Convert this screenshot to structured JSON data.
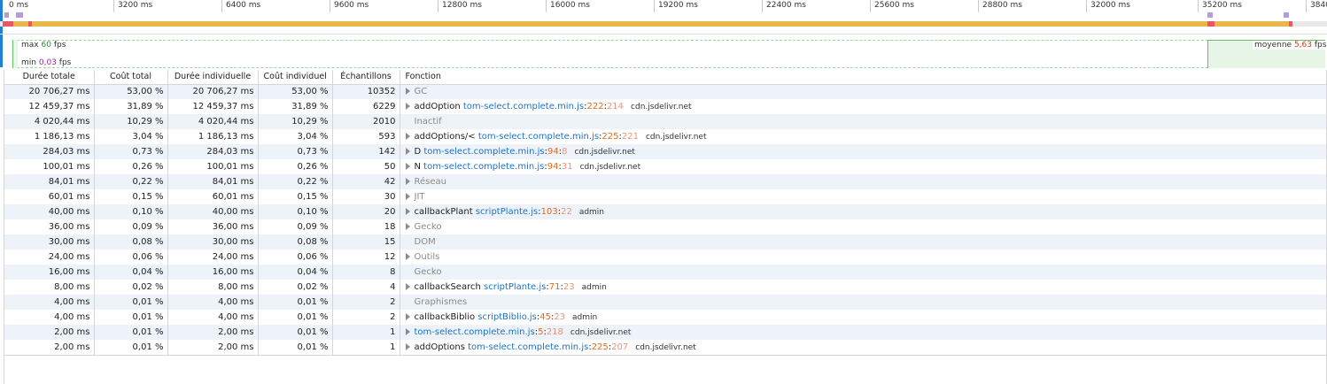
{
  "timeline": {
    "ticks": [
      "0 ms",
      "3200 ms",
      "6400 ms",
      "9600 ms",
      "12800 ms",
      "16000 ms",
      "19200 ms",
      "22400 ms",
      "25600 ms",
      "28800 ms",
      "32000 ms",
      "35200 ms",
      "3840"
    ],
    "colors": {
      "gc_bar": "#e8b84a",
      "purple_marker": "#b59cdb",
      "red_segment": "#e8566a",
      "blue_marker": "#1f7fd9"
    }
  },
  "fps": {
    "max_label": "max",
    "max_value": "60",
    "min_label": "min",
    "min_value": "0,03",
    "avg_label": "moyenne",
    "avg_value": "5,63",
    "unit": "fps"
  },
  "table": {
    "headers": [
      "Durée totale",
      "Coût total",
      "Durée individuelle",
      "Coût individuel",
      "Échantillons",
      "Fonction"
    ],
    "rows": [
      {
        "total": "20 706,27 ms",
        "cost": "53,00 %",
        "self": "20 706,27 ms",
        "self_cost": "53,00 %",
        "samples": "10352",
        "expand": true,
        "name": "GC",
        "dim": true,
        "file": "",
        "line": "",
        "col": "",
        "host": ""
      },
      {
        "total": "12 459,37 ms",
        "cost": "31,89 %",
        "self": "12 459,37 ms",
        "self_cost": "31,89 %",
        "samples": "6229",
        "expand": true,
        "name": "addOption",
        "dim": false,
        "file": "tom-select.complete.min.js",
        "line": "222",
        "col": "214",
        "host": "cdn.jsdelivr.net"
      },
      {
        "total": "4 020,44 ms",
        "cost": "10,29 %",
        "self": "4 020,44 ms",
        "self_cost": "10,29 %",
        "samples": "2010",
        "expand": false,
        "name": "Inactif",
        "dim": true,
        "file": "",
        "line": "",
        "col": "",
        "host": ""
      },
      {
        "total": "1 186,13 ms",
        "cost": "3,04 %",
        "self": "1 186,13 ms",
        "self_cost": "3,04 %",
        "samples": "593",
        "expand": true,
        "name": "addOptions/<",
        "dim": false,
        "file": "tom-select.complete.min.js",
        "line": "225",
        "col": "221",
        "host": "cdn.jsdelivr.net"
      },
      {
        "total": "284,03 ms",
        "cost": "0,73 %",
        "self": "284,03 ms",
        "self_cost": "0,73 %",
        "samples": "142",
        "expand": true,
        "name": "D",
        "dim": false,
        "file": "tom-select.complete.min.js",
        "line": "94",
        "col": "8",
        "host": "cdn.jsdelivr.net"
      },
      {
        "total": "100,01 ms",
        "cost": "0,26 %",
        "self": "100,01 ms",
        "self_cost": "0,26 %",
        "samples": "50",
        "expand": true,
        "name": "N",
        "dim": false,
        "file": "tom-select.complete.min.js",
        "line": "94",
        "col": "31",
        "host": "cdn.jsdelivr.net"
      },
      {
        "total": "84,01 ms",
        "cost": "0,22 %",
        "self": "84,01 ms",
        "self_cost": "0,22 %",
        "samples": "42",
        "expand": true,
        "name": "Réseau",
        "dim": true,
        "file": "",
        "line": "",
        "col": "",
        "host": ""
      },
      {
        "total": "60,01 ms",
        "cost": "0,15 %",
        "self": "60,01 ms",
        "self_cost": "0,15 %",
        "samples": "30",
        "expand": true,
        "name": "JIT",
        "dim": true,
        "file": "",
        "line": "",
        "col": "",
        "host": ""
      },
      {
        "total": "40,00 ms",
        "cost": "0,10 %",
        "self": "40,00 ms",
        "self_cost": "0,10 %",
        "samples": "20",
        "expand": true,
        "name": "callbackPlant",
        "dim": false,
        "file": "scriptPlante.js",
        "line": "103",
        "col": "22",
        "host": "admin"
      },
      {
        "total": "36,00 ms",
        "cost": "0,09 %",
        "self": "36,00 ms",
        "self_cost": "0,09 %",
        "samples": "18",
        "expand": true,
        "name": "Gecko",
        "dim": true,
        "file": "",
        "line": "",
        "col": "",
        "host": ""
      },
      {
        "total": "30,00 ms",
        "cost": "0,08 %",
        "self": "30,00 ms",
        "self_cost": "0,08 %",
        "samples": "15",
        "expand": false,
        "name": "DOM",
        "dim": true,
        "file": "",
        "line": "",
        "col": "",
        "host": ""
      },
      {
        "total": "24,00 ms",
        "cost": "0,06 %",
        "self": "24,00 ms",
        "self_cost": "0,06 %",
        "samples": "12",
        "expand": true,
        "name": "Outils",
        "dim": true,
        "file": "",
        "line": "",
        "col": "",
        "host": ""
      },
      {
        "total": "16,00 ms",
        "cost": "0,04 %",
        "self": "16,00 ms",
        "self_cost": "0,04 %",
        "samples": "8",
        "expand": false,
        "name": "Gecko",
        "dim": true,
        "file": "",
        "line": "",
        "col": "",
        "host": ""
      },
      {
        "total": "8,00 ms",
        "cost": "0,02 %",
        "self": "8,00 ms",
        "self_cost": "0,02 %",
        "samples": "4",
        "expand": true,
        "name": "callbackSearch",
        "dim": false,
        "file": "scriptPlante.js",
        "line": "71",
        "col": "23",
        "host": "admin"
      },
      {
        "total": "4,00 ms",
        "cost": "0,01 %",
        "self": "4,00 ms",
        "self_cost": "0,01 %",
        "samples": "2",
        "expand": false,
        "name": "Graphismes",
        "dim": true,
        "file": "",
        "line": "",
        "col": "",
        "host": ""
      },
      {
        "total": "4,00 ms",
        "cost": "0,01 %",
        "self": "4,00 ms",
        "self_cost": "0,01 %",
        "samples": "2",
        "expand": true,
        "name": "callbackBiblio",
        "dim": false,
        "file": "scriptBiblio.js",
        "line": "45",
        "col": "23",
        "host": "admin"
      },
      {
        "total": "2,00 ms",
        "cost": "0,01 %",
        "self": "2,00 ms",
        "self_cost": "0,01 %",
        "samples": "1",
        "expand": true,
        "name": "",
        "dim": false,
        "file": "tom-select.complete.min.js",
        "line": "5",
        "col": "218",
        "host": "cdn.jsdelivr.net"
      },
      {
        "total": "2,00 ms",
        "cost": "0,01 %",
        "self": "2,00 ms",
        "self_cost": "0,01 %",
        "samples": "1",
        "expand": true,
        "name": "addOptions",
        "dim": false,
        "file": "tom-select.complete.min.js",
        "line": "225",
        "col": "207",
        "host": "cdn.jsdelivr.net"
      }
    ]
  }
}
